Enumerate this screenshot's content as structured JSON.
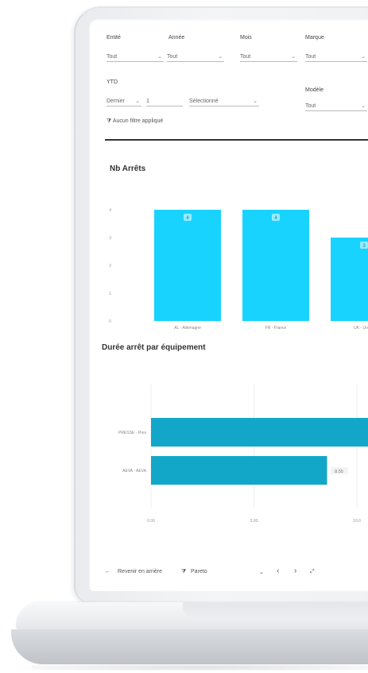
{
  "filters": {
    "entite": {
      "label": "Entité",
      "value": "Tout"
    },
    "annee": {
      "label": "Année",
      "value": "Tout"
    },
    "mois": {
      "label": "Mois",
      "value": "Tout"
    },
    "marque": {
      "label": "Marque",
      "value": "Tout"
    },
    "ytd": {
      "label": "YTD",
      "mode": "Dernier",
      "count": "1",
      "unit": "Sélectionné"
    },
    "modele": {
      "label": "Modèle",
      "value": "Tout"
    },
    "no_filter": "Aucun filtre appliqué"
  },
  "nav": {
    "back_label": "Revenir en arrière",
    "page_label": "Pareto"
  },
  "icons": {
    "back": "arrow-left-icon",
    "filter": "filter-icon",
    "dropdown": "chevron-down-icon",
    "prev": "chevron-left-icon",
    "next": "chevron-right-icon",
    "expand": "expand-icon"
  },
  "colors": {
    "bar_primary": "#19d3ff",
    "bar_secondary": "#12a7c9"
  },
  "chart_data": [
    {
      "type": "bar",
      "title": "Nb Arrêts",
      "categories": [
        "AL - Allemagne",
        "FR - France",
        "UK - United"
      ],
      "values": [
        4,
        4,
        3
      ],
      "data_labels": [
        "4",
        "4",
        "3"
      ],
      "y_ticks": [
        "0",
        "1",
        "2",
        "3",
        "4"
      ],
      "ylim": [
        0,
        4
      ]
    },
    {
      "type": "bar",
      "orientation": "horizontal",
      "title": "Durée arrêt par équipement",
      "categories": [
        "PRESSE - Pres",
        "AEVA - AEVA"
      ],
      "values": [
        11.5,
        8.55
      ],
      "data_labels": [
        "",
        "8.55"
      ],
      "x_ticks": [
        "0.00",
        "5.00",
        "10.0"
      ],
      "xlim": [
        0,
        10.5
      ]
    }
  ]
}
